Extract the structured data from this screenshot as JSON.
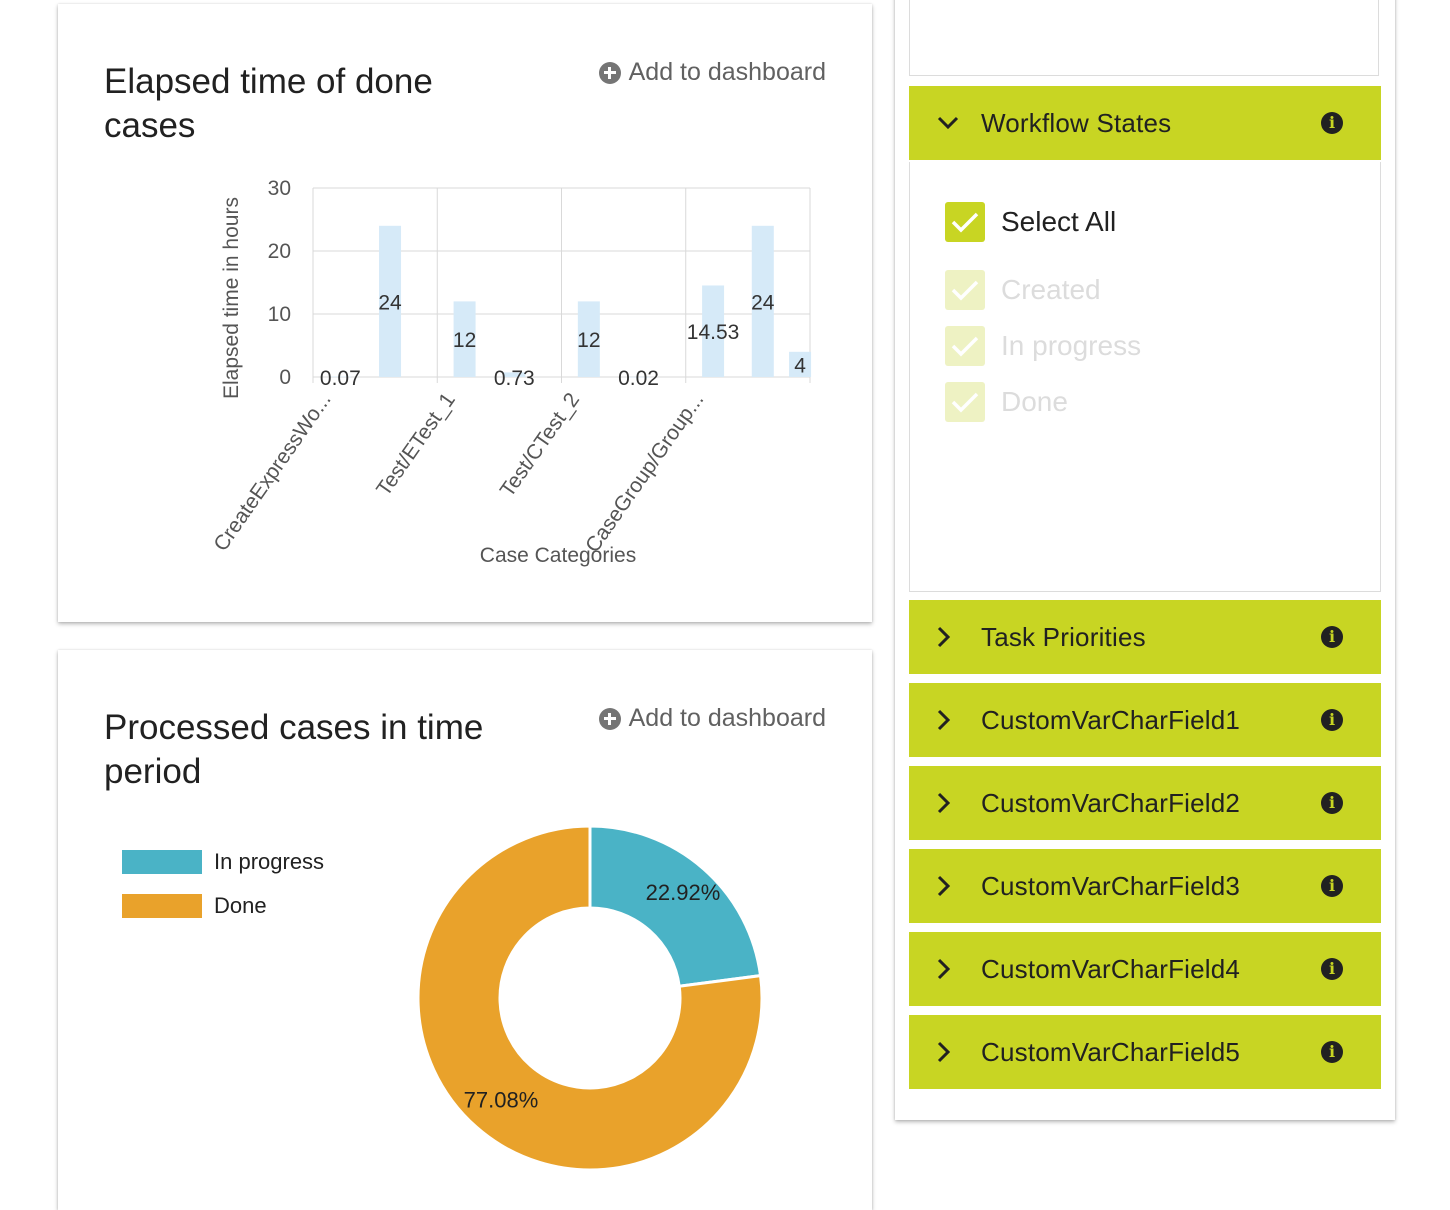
{
  "cards": {
    "elapsed": {
      "title": "Elapsed time of done cases",
      "add_label": "Add to dashboard"
    },
    "processed": {
      "title": "Processed cases in time period",
      "add_label": "Add to dashboard"
    }
  },
  "chart_data": [
    {
      "type": "bar",
      "title": "Elapsed time of done cases",
      "xlabel": "Case Categories",
      "ylabel": "Elapsed time in hours",
      "ylim": [
        0,
        30
      ],
      "yticks": [
        0,
        10,
        20,
        30
      ],
      "grid": true,
      "categories": [
        "CreateExpressWo...",
        "Test/ETest_1",
        "Test/CTest_2",
        "CaseGroup/Group..."
      ],
      "series": [
        {
          "values": [
            0.07,
            12,
            12,
            14.53
          ],
          "color": "#d6eaf8"
        },
        {
          "values": [
            24,
            0.73,
            0.02,
            24
          ],
          "color": "#d6eaf8"
        }
      ],
      "extra_bar": {
        "value": 4,
        "label": "4"
      }
    },
    {
      "type": "pie",
      "title": "Processed cases in time period",
      "donut": true,
      "slices": [
        {
          "label": "In progress",
          "value": 22.92,
          "display": "22.92%",
          "color": "#4ab3c6"
        },
        {
          "label": "Done",
          "value": 77.08,
          "display": "77.08%",
          "color": "#e9a22b"
        }
      ],
      "legend_position": "top-left"
    }
  ],
  "legend": [
    {
      "label": "In progress",
      "color": "#4ab3c6"
    },
    {
      "label": "Done",
      "color": "#e9a22b"
    }
  ],
  "filters": {
    "workflow": {
      "label": "Workflow States",
      "expanded": true,
      "select_all": "Select All",
      "options": [
        "Created",
        "In progress",
        "Done"
      ]
    },
    "collapsed": [
      "Task Priorities",
      "CustomVarCharField1",
      "CustomVarCharField2",
      "CustomVarCharField3",
      "CustomVarCharField4",
      "CustomVarCharField5"
    ],
    "accent": "#c8d523"
  }
}
